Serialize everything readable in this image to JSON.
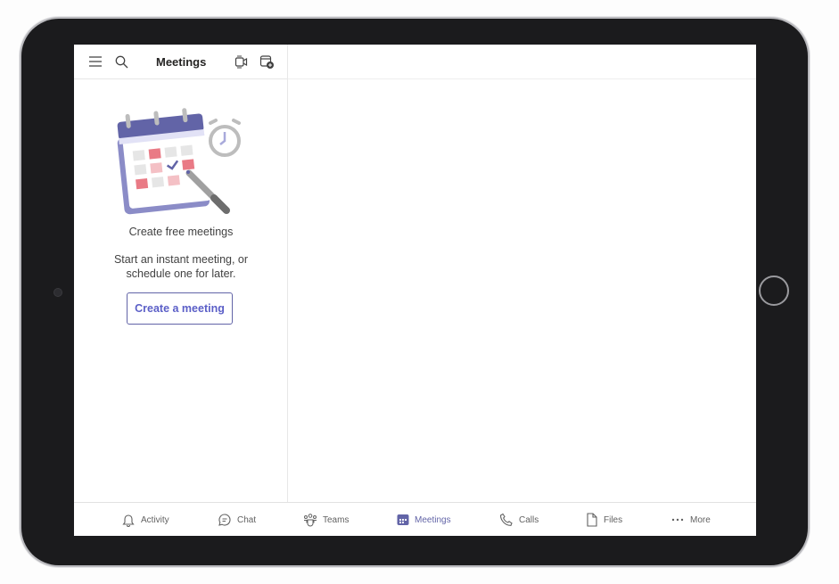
{
  "header": {
    "title": "Meetings"
  },
  "empty_state": {
    "heading": "Create free meetings",
    "line1": "Start an instant meeting, or",
    "line2": "schedule one for later.",
    "button": "Create a meeting"
  },
  "nav": {
    "items": [
      {
        "label": "Activity",
        "icon": "bell-icon"
      },
      {
        "label": "Chat",
        "icon": "chat-icon"
      },
      {
        "label": "Teams",
        "icon": "teams-icon"
      },
      {
        "label": "Meetings",
        "icon": "calendar-icon",
        "active": true
      },
      {
        "label": "Calls",
        "icon": "phone-icon"
      },
      {
        "label": "Files",
        "icon": "file-icon"
      },
      {
        "label": "More",
        "icon": "ellipsis-icon"
      }
    ]
  },
  "colors": {
    "accent": "#6264a7",
    "text": "#424242"
  }
}
